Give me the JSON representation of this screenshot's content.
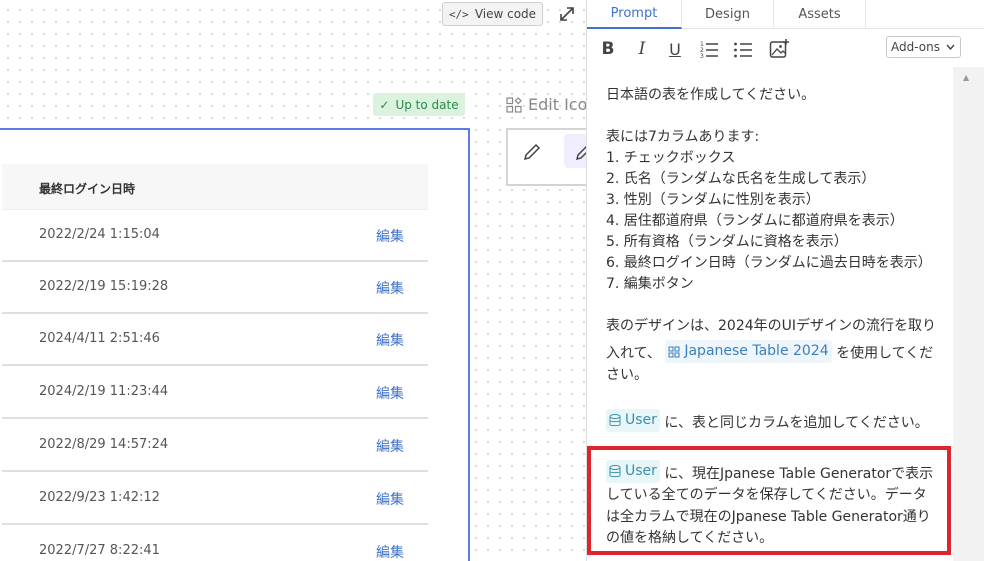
{
  "canvas": {
    "view_code_label": "View code",
    "status_badge": "Up to date",
    "edit_icons_title": "Edit Ico"
  },
  "table": {
    "header": "最終ログイン日時",
    "rows": [
      {
        "date": "2022/2/24 1:15:04",
        "action": "編集"
      },
      {
        "date": "2022/2/19 15:19:28",
        "action": "編集"
      },
      {
        "date": "2024/4/11 2:51:46",
        "action": "編集"
      },
      {
        "date": "2024/2/19 11:23:44",
        "action": "編集"
      },
      {
        "date": "2022/8/29 14:57:24",
        "action": "編集"
      },
      {
        "date": "2022/9/23 1:42:12",
        "action": "編集"
      },
      {
        "date": "2022/7/27 8:22:41",
        "action": "編集"
      }
    ]
  },
  "panel": {
    "tabs": [
      "Prompt",
      "Design",
      "Assets"
    ],
    "addons_label": "Add-ons",
    "prompt": {
      "l1": "日本語の表を作成してください。",
      "l2": "表には7カラムあります:",
      "l3": "1. チェックボックス",
      "l4": "2. 氏名（ランダムな氏名を生成して表示）",
      "l5": "3. 性別（ランダムに性別を表示）",
      "l6": "4. 居住都道府県（ランダムに都道府県を表示）",
      "l7": "5. 所有資格（ランダムに資格を表示）",
      "l8": "6. 最終ログイン日時（ランダムに過去日時を表示）",
      "l9": "7. 編集ボタン",
      "l10": "表のデザインは、2024年のUIデザインの流行を取り",
      "l11_pre": "入れて、",
      "chip_table": "Japanese Table 2024",
      "l11_post": "を使用してくだ",
      "l12": "さい。",
      "chip_user1": "User",
      "l13_post": "に、表と同じカラムを追加してください。",
      "chip_user2": "User",
      "l14_post": "に、現在Jpanese Table Generatorで表示",
      "l15": "している全てのデータを保存してください。データ",
      "l16": "は全カラムで現在のJpanese Table Generator通り",
      "l17": "の値を格納してください。"
    }
  }
}
